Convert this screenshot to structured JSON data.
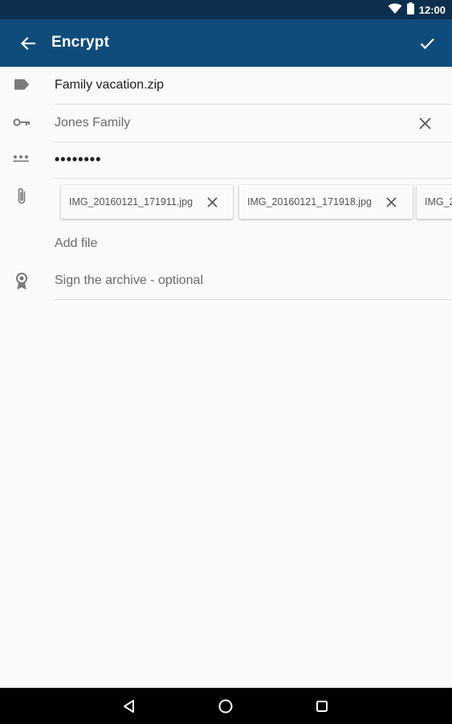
{
  "status_bar": {
    "time": "12:00",
    "icons": [
      "wifi-icon",
      "battery-icon"
    ]
  },
  "app_bar": {
    "title": "Encrypt",
    "back_icon": "arrow-back-icon",
    "confirm_icon": "check-icon"
  },
  "form": {
    "filename": {
      "icon": "label-tag-icon",
      "value": "Family vacation.zip"
    },
    "key": {
      "icon": "key-icon",
      "value": "Jones Family",
      "clear_icon": "close-icon"
    },
    "password": {
      "icon": "password-dots-icon",
      "value": "••••••••"
    },
    "attachments": {
      "icon": "paperclip-icon",
      "files": [
        {
          "name": "IMG_20160121_171911.jpg"
        },
        {
          "name": "IMG_20160121_171918.jpg"
        },
        {
          "name": "IMG_2"
        }
      ],
      "add_label": "Add file"
    },
    "signature": {
      "icon": "award-ribbon-icon",
      "label": "Sign the archive - optional"
    }
  },
  "nav_bar": {
    "icons": [
      "back-triangle-icon",
      "home-circle-icon",
      "recents-square-icon"
    ]
  },
  "colors": {
    "app_bar": "#0f4c7c",
    "status_bar": "#0b2f4c",
    "background": "#fafafa"
  }
}
